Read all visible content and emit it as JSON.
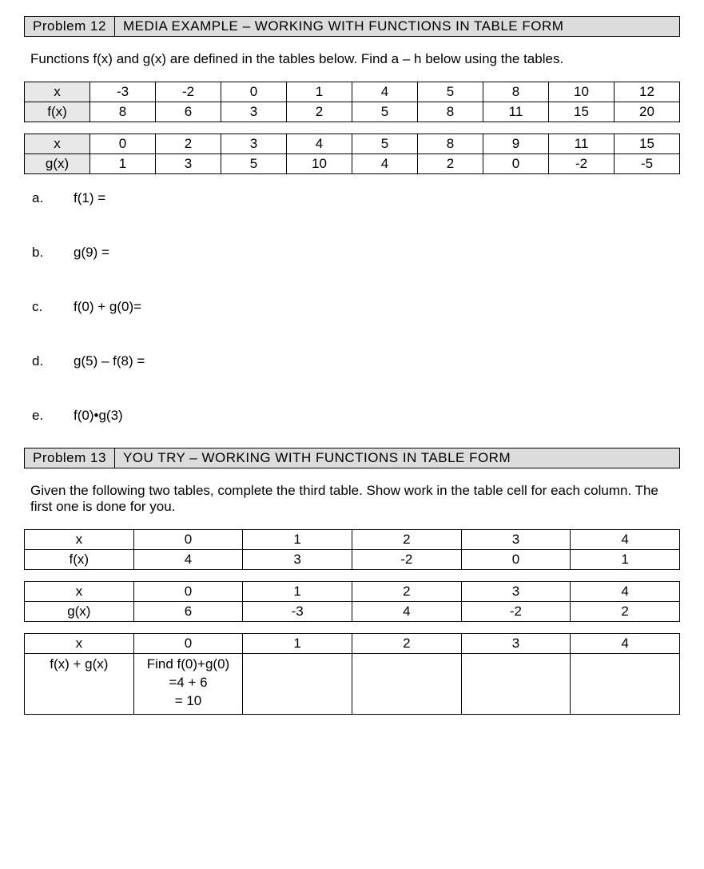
{
  "p12": {
    "num": "Problem 12",
    "title": "MEDIA EXAMPLE – WORKING WITH FUNCTIONS IN TABLE FORM",
    "intro": "Functions f(x) and g(x) are defined in the tables below. Find a – h below using the tables.",
    "tableF": {
      "r0": [
        "x",
        "-3",
        "-2",
        "0",
        "1",
        "4",
        "5",
        "8",
        "10",
        "12"
      ],
      "r1": [
        "f(x)",
        "8",
        "6",
        "3",
        "2",
        "5",
        "8",
        "11",
        "15",
        "20"
      ]
    },
    "tableG": {
      "r0": [
        "x",
        "0",
        "2",
        "3",
        "4",
        "5",
        "8",
        "9",
        "11",
        "15"
      ],
      "r1": [
        "g(x)",
        "1",
        "3",
        "5",
        "10",
        "4",
        "2",
        "0",
        "-2",
        "-5"
      ]
    },
    "q": {
      "a": {
        "letter": "a.",
        "expr": "f(1) ="
      },
      "b": {
        "letter": "b.",
        "expr": "g(9) ="
      },
      "c": {
        "letter": "c.",
        "expr": "f(0) + g(0)="
      },
      "d": {
        "letter": "d.",
        "expr": "g(5) – f(8) ="
      },
      "e": {
        "letter": "e.",
        "expr": "f(0)•g(3)"
      }
    }
  },
  "p13": {
    "num": "Problem 13",
    "title": "YOU TRY – WORKING WITH FUNCTIONS IN TABLE FORM",
    "intro": "Given the following two tables, complete the third table. Show work in the table cell for each column. The first one is done for you.",
    "tableF": {
      "r0": [
        "x",
        "0",
        "1",
        "2",
        "3",
        "4"
      ],
      "r1": [
        "f(x)",
        "4",
        "3",
        "-2",
        "0",
        "1"
      ]
    },
    "tableG": {
      "r0": [
        "x",
        "0",
        "1",
        "2",
        "3",
        "4"
      ],
      "r1": [
        "g(x)",
        "6",
        "-3",
        "4",
        "-2",
        "2"
      ]
    },
    "tableSum": {
      "r0": [
        "x",
        "0",
        "1",
        "2",
        "3",
        "4"
      ],
      "label": "f(x) + g(x)",
      "work_l1": "Find f(0)+g(0)",
      "work_l2": "=4 + 6",
      "work_l3": "= 10"
    }
  }
}
